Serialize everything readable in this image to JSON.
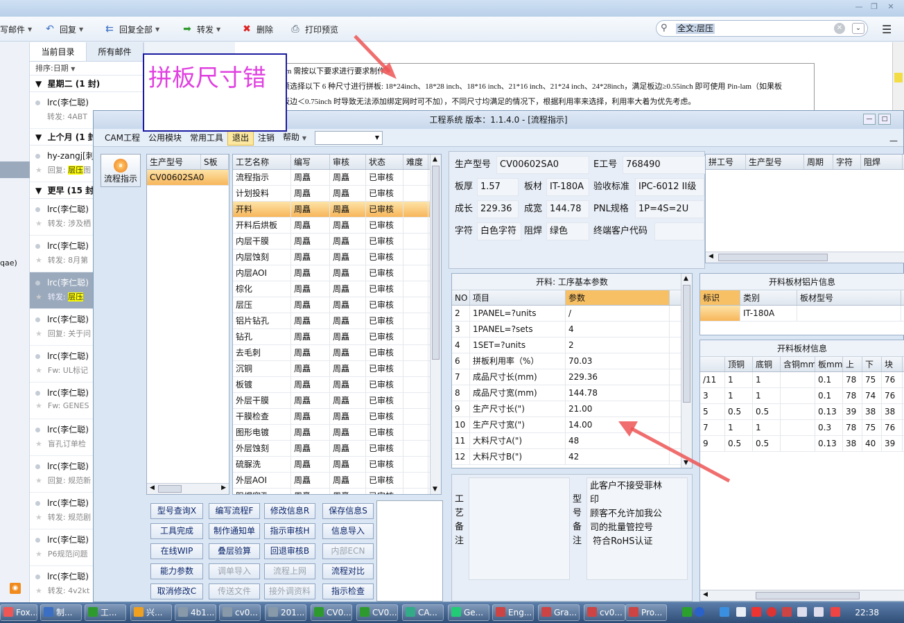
{
  "mail": {
    "toolbar": {
      "write": "写邮件",
      "reply": "回复",
      "reply_all": "回复全部",
      "forward": "转发",
      "delete": "删除",
      "print_preview": "打印预览"
    },
    "search": {
      "value": "全文:层压"
    },
    "tabs": [
      "当前目录",
      "所有邮件"
    ],
    "sort_label": "排序:日期",
    "groups": [
      "星期二 (1 封)",
      "上个月 (1 封",
      "更早 (15 封"
    ],
    "items": [
      {
        "from": "lrc(李仁聪)",
        "subject": "转发: 4ABT"
      },
      {
        "from": "hy-zangj[刺",
        "subject_prefix": "回复: ",
        "subject_hl": "层压",
        "subject": "图"
      },
      {
        "from": "lrc(李仁聪)",
        "subject": "转发: 涉及栖"
      },
      {
        "from": "lrc(李仁聪)",
        "subject": "转发: 8月第"
      },
      {
        "from": "lrc(李仁聪)",
        "subject_prefix": "转发: ",
        "subject_hl": "层压",
        "subject": ""
      },
      {
        "from": "lrc(李仁聪)",
        "subject": "回复: 关于问"
      },
      {
        "from": "lrc(李仁聪)",
        "subject": "Fw: UL标记"
      },
      {
        "from": "lrc(李仁聪)",
        "subject": "Fw: GENES"
      },
      {
        "from": "lrc(李仁聪)",
        "subject": "盲孔订单检"
      },
      {
        "from": "lrc(李仁聪)",
        "subject": "回复: 规范新"
      },
      {
        "from": "lrc(李仁聪)",
        "subject": "转发: 规范剧"
      },
      {
        "from": "lrc(李仁聪)",
        "subject": "P6规范问题"
      },
      {
        "from": "lrc(李仁聪)",
        "subject": "转发: 4v2kt"
      }
    ],
    "left_strip_text": "qae)",
    "body_lines": [
      "am 需按以下要求进行要求制作:",
      "须选择以下 6 种尺寸进行拼板: 18*24inch、18*28 inch、18*16 inch、21*16 inch、21*24 inch、24*28inch，满足板边≥0.55inch 即可使用 Pin-lam（如果板",
      "板边＜0.75inch 时导致无法添加绑定网时可不加），不同尺寸均满足的情况下，根据利用率来选择，利用率大着为优先考虑。"
    ]
  },
  "annotation": "拼板尺寸错",
  "cam": {
    "title": "工程系统   版本：1.1.4.0 - [流程指示]",
    "menu": [
      "CAM工程",
      "公用模块",
      "常用工具",
      "退出",
      "注销",
      "帮助"
    ],
    "side_button": "流程指示",
    "model_grid": {
      "headers": [
        "生产型号",
        "S板"
      ],
      "rows": [
        [
          "CV00602SA0",
          ""
        ]
      ]
    },
    "process_grid": {
      "headers": [
        "工艺名称",
        "编写",
        "审核",
        "状态",
        "难度"
      ],
      "rows": [
        [
          "流程指示",
          "周矗",
          "周矗",
          "已审核"
        ],
        [
          "计划投料",
          "周矗",
          "周矗",
          "已审核"
        ],
        [
          "开料",
          "周矗",
          "周矗",
          "已审核"
        ],
        [
          "开料后烘板",
          "周矗",
          "周矗",
          "已审核"
        ],
        [
          "内层干膜",
          "周矗",
          "周矗",
          "已审核"
        ],
        [
          "内层蚀刻",
          "周矗",
          "周矗",
          "已审核"
        ],
        [
          "内层AOI",
          "周矗",
          "周矗",
          "已审核"
        ],
        [
          "棕化",
          "周矗",
          "周矗",
          "已审核"
        ],
        [
          "层压",
          "周矗",
          "周矗",
          "已审核"
        ],
        [
          "铝片钻孔",
          "周矗",
          "周矗",
          "已审核"
        ],
        [
          "钻孔",
          "周矗",
          "周矗",
          "已审核"
        ],
        [
          "去毛刺",
          "周矗",
          "周矗",
          "已审核"
        ],
        [
          "沉铜",
          "周矗",
          "周矗",
          "已审核"
        ],
        [
          "板镀",
          "周矗",
          "周矗",
          "已审核"
        ],
        [
          "外层干膜",
          "周矗",
          "周矗",
          "已审核"
        ],
        [
          "干膜检查",
          "周矗",
          "周矗",
          "已审核"
        ],
        [
          "图形电镀",
          "周矗",
          "周矗",
          "已审核"
        ],
        [
          "外层蚀刻",
          "周矗",
          "周矗",
          "已审核"
        ],
        [
          "硫脲洗",
          "周矗",
          "周矗",
          "已审核"
        ],
        [
          "外层AOI",
          "周矗",
          "周矗",
          "已审核"
        ],
        [
          "阻焊塞孔",
          "周矗",
          "周矗",
          "已审核"
        ]
      ]
    },
    "buttons": [
      [
        "型号查询X",
        "编写流程F",
        "修改信息R",
        "保存信息S"
      ],
      [
        "工具完成",
        "制作通知单",
        "指示审核H",
        "信息导入"
      ],
      [
        "在线WIP",
        "叠层验算",
        "回退审核B",
        "内部ECN"
      ],
      [
        "能力参数",
        "调单导入",
        "流程上网",
        "流程对比"
      ],
      [
        "取消修改C",
        "传送文件",
        "接外调资料",
        "指示检查"
      ]
    ],
    "info": {
      "prod_model_label": "生产型号",
      "prod_model": "CV00602SA0",
      "e_no_label": "E工号",
      "e_no": "768490",
      "thickness_label": "板厚",
      "thickness": "1.57",
      "material_label": "板材",
      "material": "IT-180A",
      "accept_label": "验收标准",
      "accept": "IPC-6012 II级",
      "len_label": "成长",
      "len": "229.36",
      "wid_label": "成宽",
      "wid": "144.78",
      "pnl_label": "PNL规格",
      "pnl": "1P=4S=2U",
      "char_label": "字符",
      "char": "白色字符",
      "mask_label": "阻焊",
      "mask": "绿色",
      "endcust_label": "终端客户代码",
      "endcust": ""
    },
    "top_right_headers": [
      "拼工号",
      "生产型号",
      "周期",
      "字符",
      "阻焊"
    ],
    "params": {
      "title": "开料: 工序基本参数",
      "headers": [
        "NO",
        "项目",
        "参数"
      ],
      "rows": [
        [
          "2",
          "1PANEL=?units",
          "/"
        ],
        [
          "3",
          "1PANEL=?sets",
          "4"
        ],
        [
          "4",
          "1SET=?units",
          "2"
        ],
        [
          "6",
          "拼板利用率（%）",
          "70.03"
        ],
        [
          "7",
          "成品尺寸长(mm)",
          "229.36"
        ],
        [
          "8",
          "成品尺寸宽(mm)",
          "144.78"
        ],
        [
          "9",
          "生产尺寸长(\")",
          "21.00"
        ],
        [
          "10",
          "生产尺寸宽(\")",
          "14.00"
        ],
        [
          "11",
          "大料尺寸A(\")",
          "48"
        ],
        [
          "12",
          "大料尺寸B(\")",
          "42"
        ]
      ]
    },
    "alu": {
      "title": "开料板材铝片信息",
      "headers": [
        "标识",
        "类别",
        "板材型号"
      ],
      "rows": [
        [
          "",
          "IT-180A",
          ""
        ]
      ]
    },
    "board": {
      "title": "开料板材信息",
      "headers": [
        "",
        "顶铜",
        "底铜",
        "含铜mm",
        "板mm",
        "上",
        "下",
        "块"
      ],
      "rows": [
        [
          "/11",
          "1",
          "1",
          "",
          "0.1",
          "78",
          "75",
          "76"
        ],
        [
          "3",
          "1",
          "1",
          "",
          "0.1",
          "78",
          "74",
          "76"
        ],
        [
          "5",
          "0.5",
          "0.5",
          "",
          "0.13",
          "39",
          "38",
          "38"
        ],
        [
          "7",
          "1",
          "1",
          "",
          "0.3",
          "78",
          "75",
          "76"
        ],
        [
          "9",
          "0.5",
          "0.5",
          "",
          "0.13",
          "38",
          "40",
          "39"
        ]
      ]
    },
    "craft_note_label": "工艺备注",
    "model_note_label": "型号备注",
    "model_note_lines": [
      "此客户不接受菲林",
      "印",
      "顾客不允许加我公",
      "司的批量管控号",
      " 符合RoHS认证"
    ]
  },
  "taskbar": {
    "items": [
      "Fox...",
      "制...",
      "工...",
      "兴...",
      "4b1...",
      "cv0...",
      "201...",
      "CV0...",
      "CV0...",
      "CA...",
      "Ge...",
      "Eng...",
      "Gra...",
      "cv0...",
      "Pro..."
    ],
    "clock": "22:38"
  },
  "colors": {
    "accent": "#f7b65a",
    "annotation_text": "#e040e0",
    "arrow": "#ee5555",
    "highlight": "#ffff00"
  }
}
